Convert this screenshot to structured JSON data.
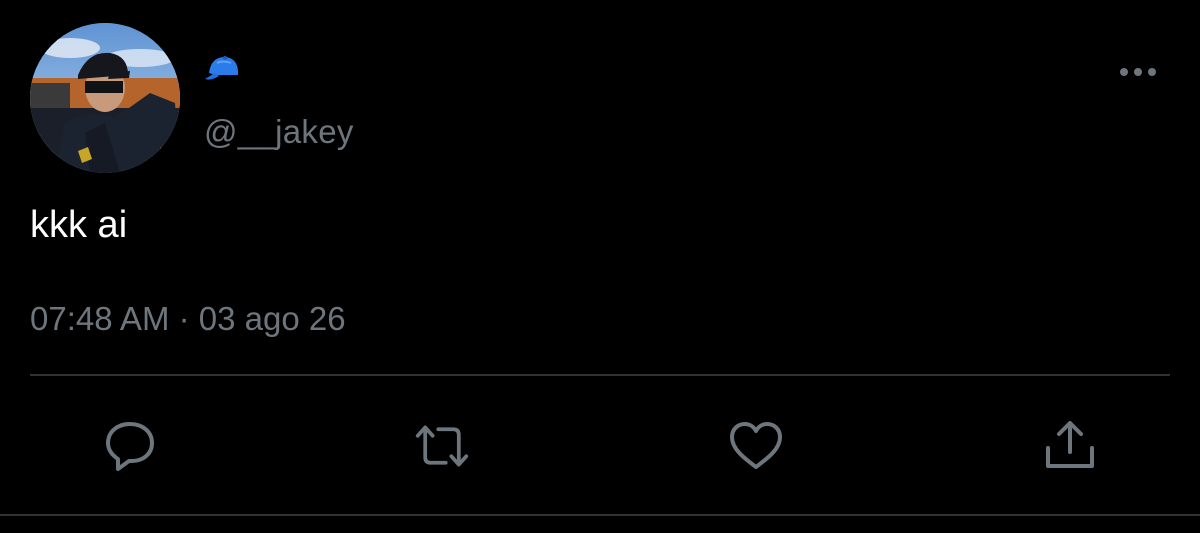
{
  "tweet": {
    "display_name_icon": "blue-cap-icon",
    "handle": "@__jakey",
    "text": "kkk ai",
    "time": "07:48 AM",
    "separator": "·",
    "date": "03 ago 26"
  },
  "actions": [
    "reply-icon",
    "retweet-icon",
    "like-icon",
    "share-icon"
  ],
  "colors": {
    "background": "#000000",
    "text": "#ffffff",
    "secondary": "#6e767d",
    "divider": "#2f3336",
    "cap_emoji": "#1f6fe0"
  }
}
